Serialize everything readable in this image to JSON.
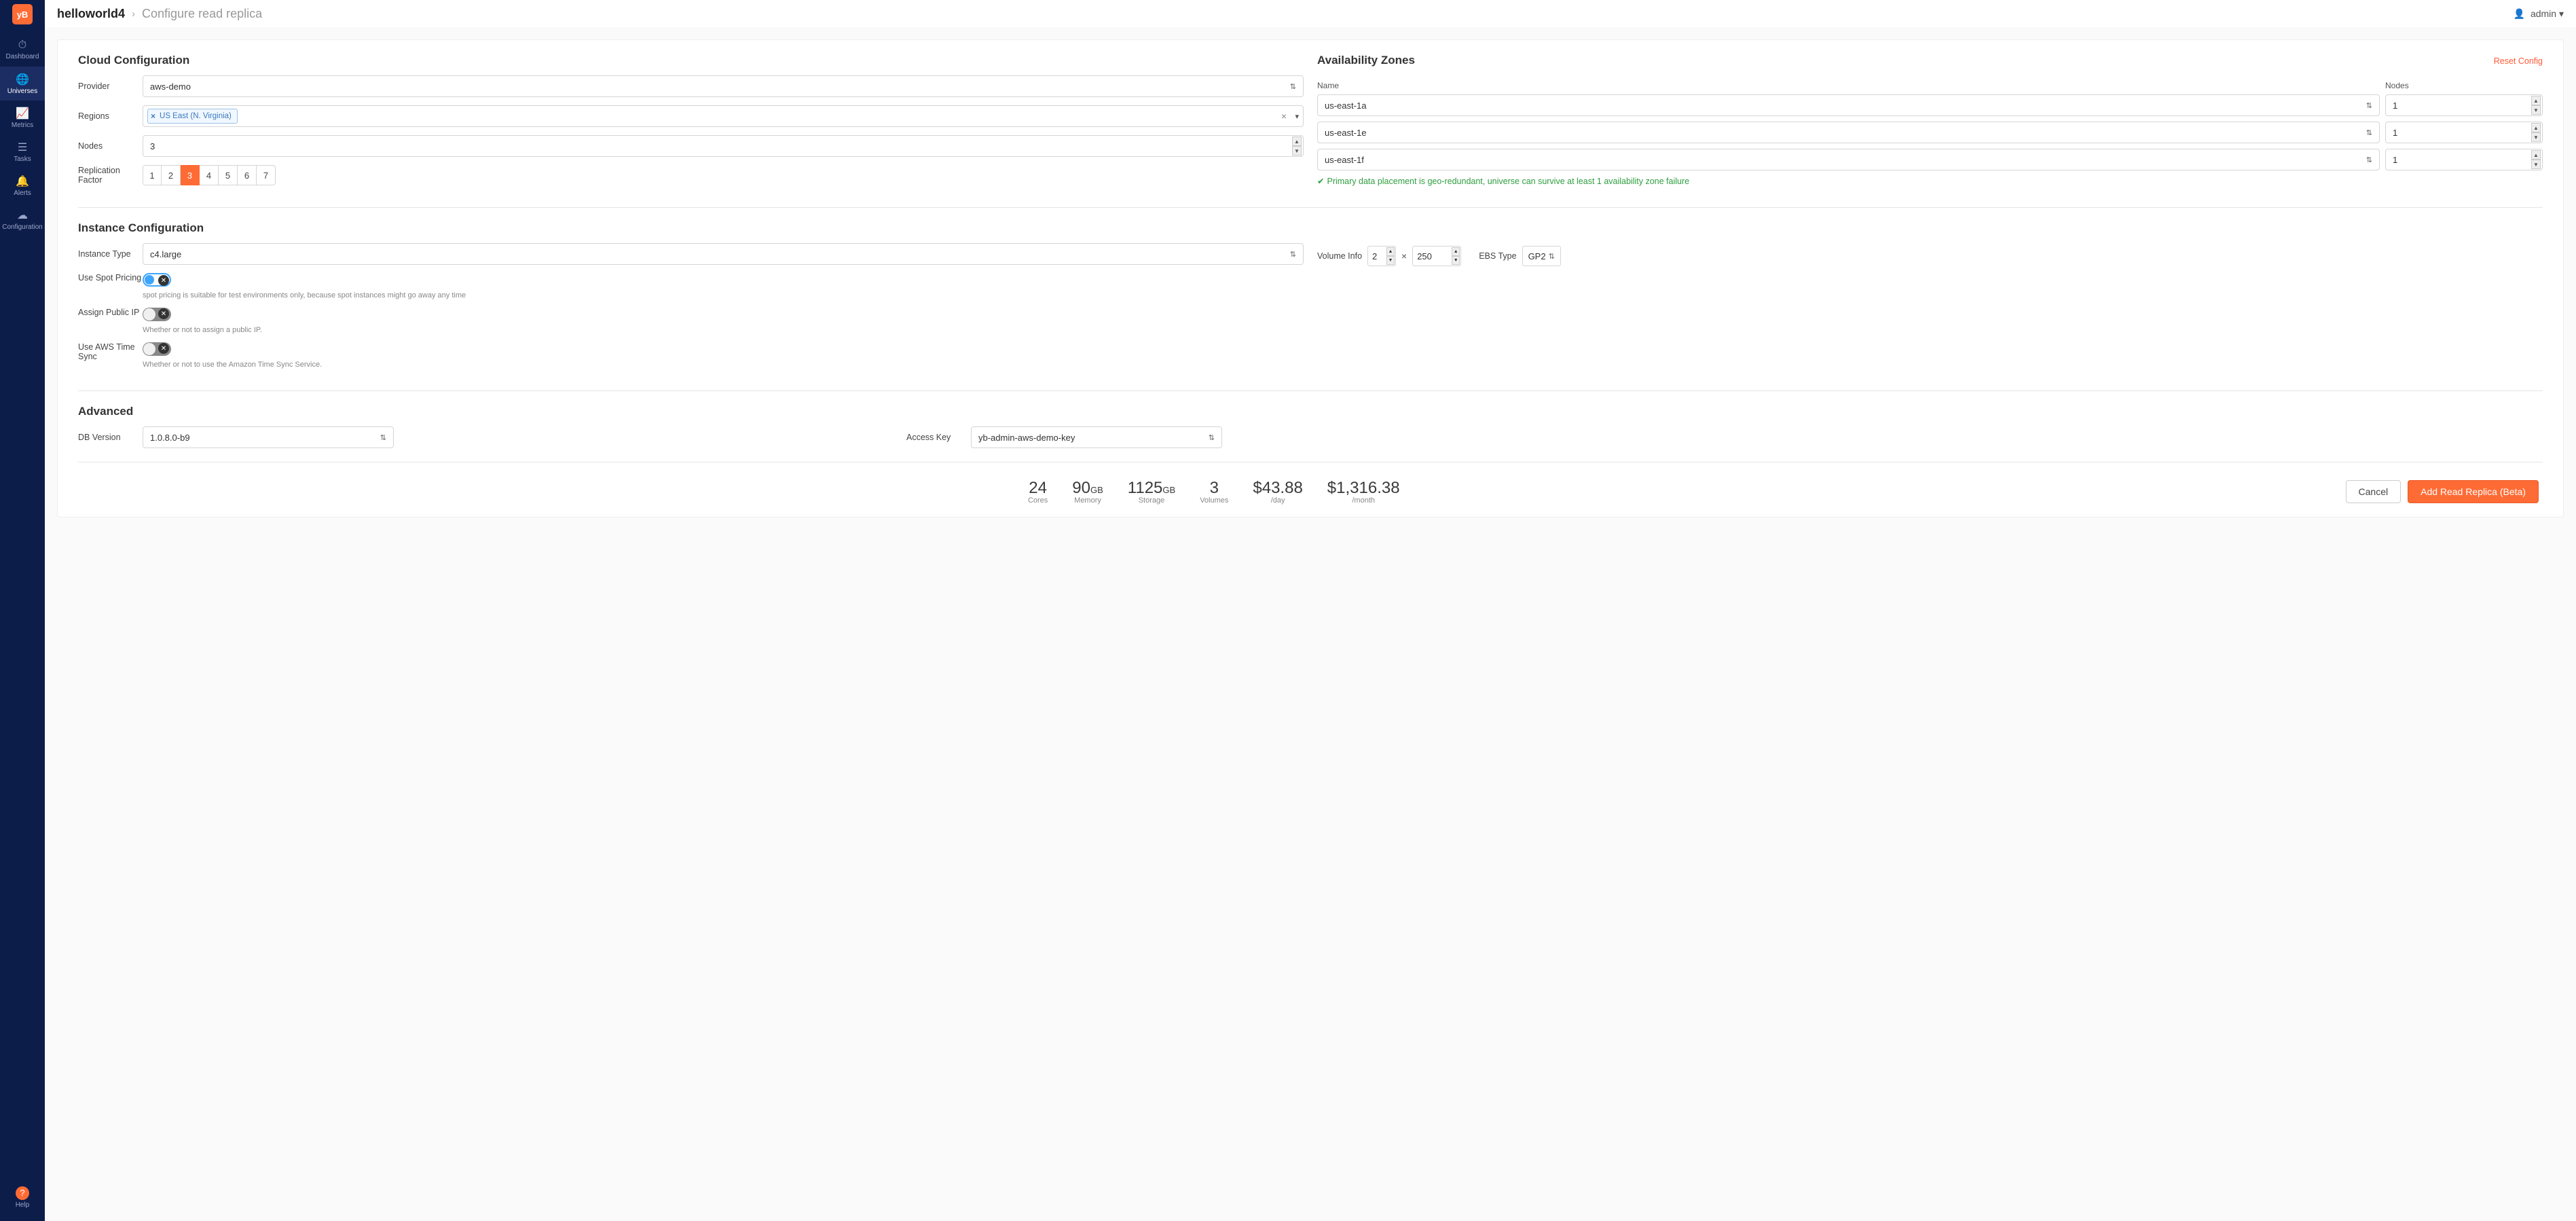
{
  "logo_text": "yB",
  "sidebar": {
    "items": [
      {
        "label": "Dashboard",
        "icon": "◉"
      },
      {
        "label": "Universes",
        "icon": "🌐"
      },
      {
        "label": "Metrics",
        "icon": "📈"
      },
      {
        "label": "Tasks",
        "icon": "☰"
      },
      {
        "label": "Alerts",
        "icon": "🔔"
      },
      {
        "label": "Configuration",
        "icon": "☁"
      }
    ],
    "help": {
      "label": "Help",
      "icon": "?"
    }
  },
  "header": {
    "universe_name": "helloworld4",
    "subtitle": "Configure read replica",
    "user": "admin"
  },
  "cloud": {
    "title": "Cloud Configuration",
    "provider_label": "Provider",
    "provider_value": "aws-demo",
    "regions_label": "Regions",
    "region_tag": "US East (N. Virginia)",
    "nodes_label": "Nodes",
    "nodes_value": "3",
    "rf_label": "Replication Factor",
    "rf_options": [
      "1",
      "2",
      "3",
      "4",
      "5",
      "6",
      "7"
    ],
    "rf_selected": "3"
  },
  "az": {
    "title": "Availability Zones",
    "reset": "Reset Config",
    "name_label": "Name",
    "nodes_label": "Nodes",
    "rows": [
      {
        "zone": "us-east-1a",
        "nodes": "1"
      },
      {
        "zone": "us-east-1e",
        "nodes": "1"
      },
      {
        "zone": "us-east-1f",
        "nodes": "1"
      }
    ],
    "geo_note": "Primary data placement is geo-redundant, universe can survive at least 1 availability zone failure"
  },
  "instance": {
    "title": "Instance Configuration",
    "type_label": "Instance Type",
    "type_value": "c4.large",
    "volume_label": "Volume Info",
    "volume_count": "2",
    "volume_size": "250",
    "ebs_label": "EBS Type",
    "ebs_value": "GP2",
    "spot_label": "Use Spot Pricing",
    "spot_help": "spot pricing is suitable for test environments only, because spot instances might go away any time",
    "public_ip_label": "Assign Public IP",
    "public_ip_help": "Whether or not to assign a public IP.",
    "timesync_label": "Use AWS Time Sync",
    "timesync_help": "Whether or not to use the Amazon Time Sync Service."
  },
  "advanced": {
    "title": "Advanced",
    "db_label": "DB Version",
    "db_value": "1.0.8.0-b9",
    "key_label": "Access Key",
    "key_value": "yb-admin-aws-demo-key"
  },
  "summary": {
    "cores": {
      "value": "24",
      "unit": "",
      "label": "Cores"
    },
    "memory": {
      "value": "90",
      "unit": "GB",
      "label": "Memory"
    },
    "storage": {
      "value": "1125",
      "unit": "GB",
      "label": "Storage"
    },
    "volumes": {
      "value": "3",
      "unit": "",
      "label": "Volumes"
    },
    "day": {
      "value": "$43.88",
      "unit": "",
      "label": "/day"
    },
    "month": {
      "value": "$1,316.38",
      "unit": "",
      "label": "/month"
    }
  },
  "actions": {
    "cancel": "Cancel",
    "primary": "Add Read Replica (Beta)"
  }
}
